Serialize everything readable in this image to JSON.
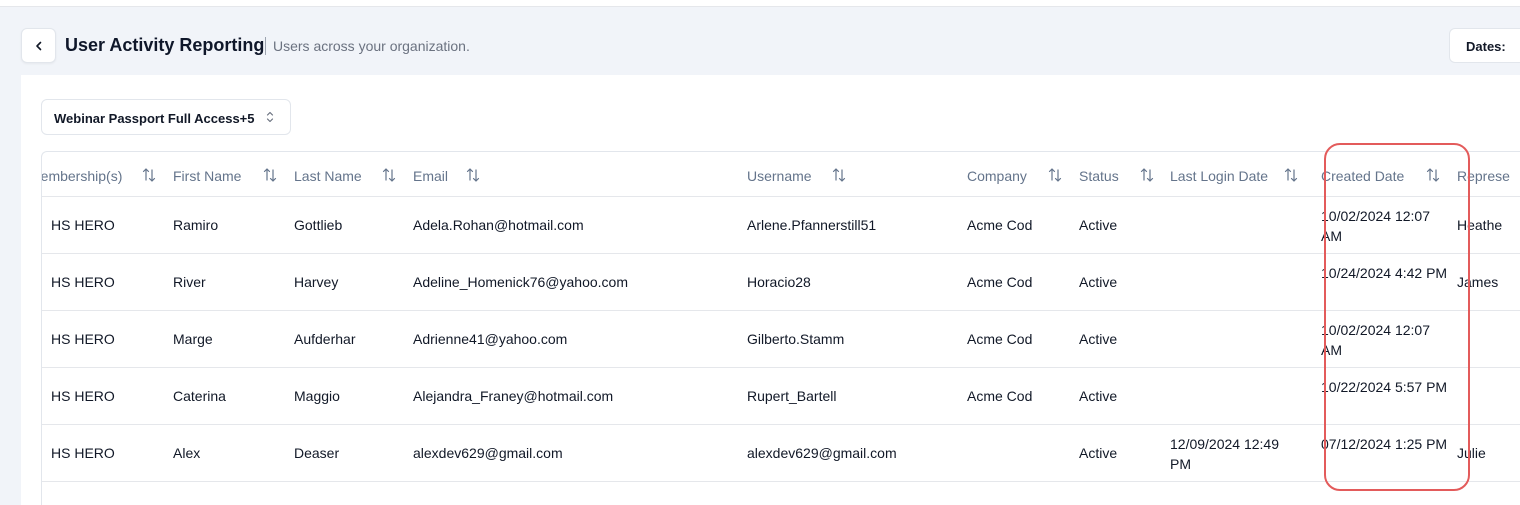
{
  "header": {
    "title": "User Activity Reporting",
    "subtitle": "Users across your organization.",
    "dates_label": "Dates:"
  },
  "filter": {
    "value": "Webinar Passport Full Access+5"
  },
  "table": {
    "columns": [
      "Membership(s)",
      "First Name",
      "Last Name",
      "Email",
      "Username",
      "Company",
      "Status",
      "Last Login Date",
      "Created Date",
      "Represe"
    ],
    "rows": [
      [
        "HS HERO",
        "Ramiro",
        "Gottlieb",
        "Adela.Rohan@hotmail.com",
        "Arlene.Pfannerstill51",
        "Acme Cod",
        "Active",
        "",
        "10/02/2024 12:07 AM",
        "Heathe"
      ],
      [
        "HS HERO",
        "River",
        "Harvey",
        "Adeline_Homenick76@yahoo.com",
        "Horacio28",
        "Acme Cod",
        "Active",
        "",
        "10/24/2024 4:42 PM",
        "James"
      ],
      [
        "HS HERO",
        "Marge",
        "Aufderhar",
        "Adrienne41@yahoo.com",
        "Gilberto.Stamm",
        "Acme Cod",
        "Active",
        "",
        "10/02/2024 12:07 AM",
        ""
      ],
      [
        "HS HERO",
        "Caterina",
        "Maggio",
        "Alejandra_Franey@hotmail.com",
        "Rupert_Bartell",
        "Acme Cod",
        "Active",
        "",
        "10/22/2024 5:57 PM",
        ""
      ],
      [
        "HS HERO",
        "Alex",
        "Deaser",
        "alexdev629@gmail.com",
        "alexdev629@gmail.com",
        "",
        "Active",
        "12/09/2024 12:49 PM",
        "07/12/2024 1:25 PM",
        "Julie"
      ]
    ]
  },
  "highlight": {
    "column": "Created Date",
    "color": "#e35b5b"
  },
  "icons": {
    "back": "chevron-left-icon",
    "sort": "sort-arrows-icon",
    "select": "chevron-up-down-icon"
  }
}
